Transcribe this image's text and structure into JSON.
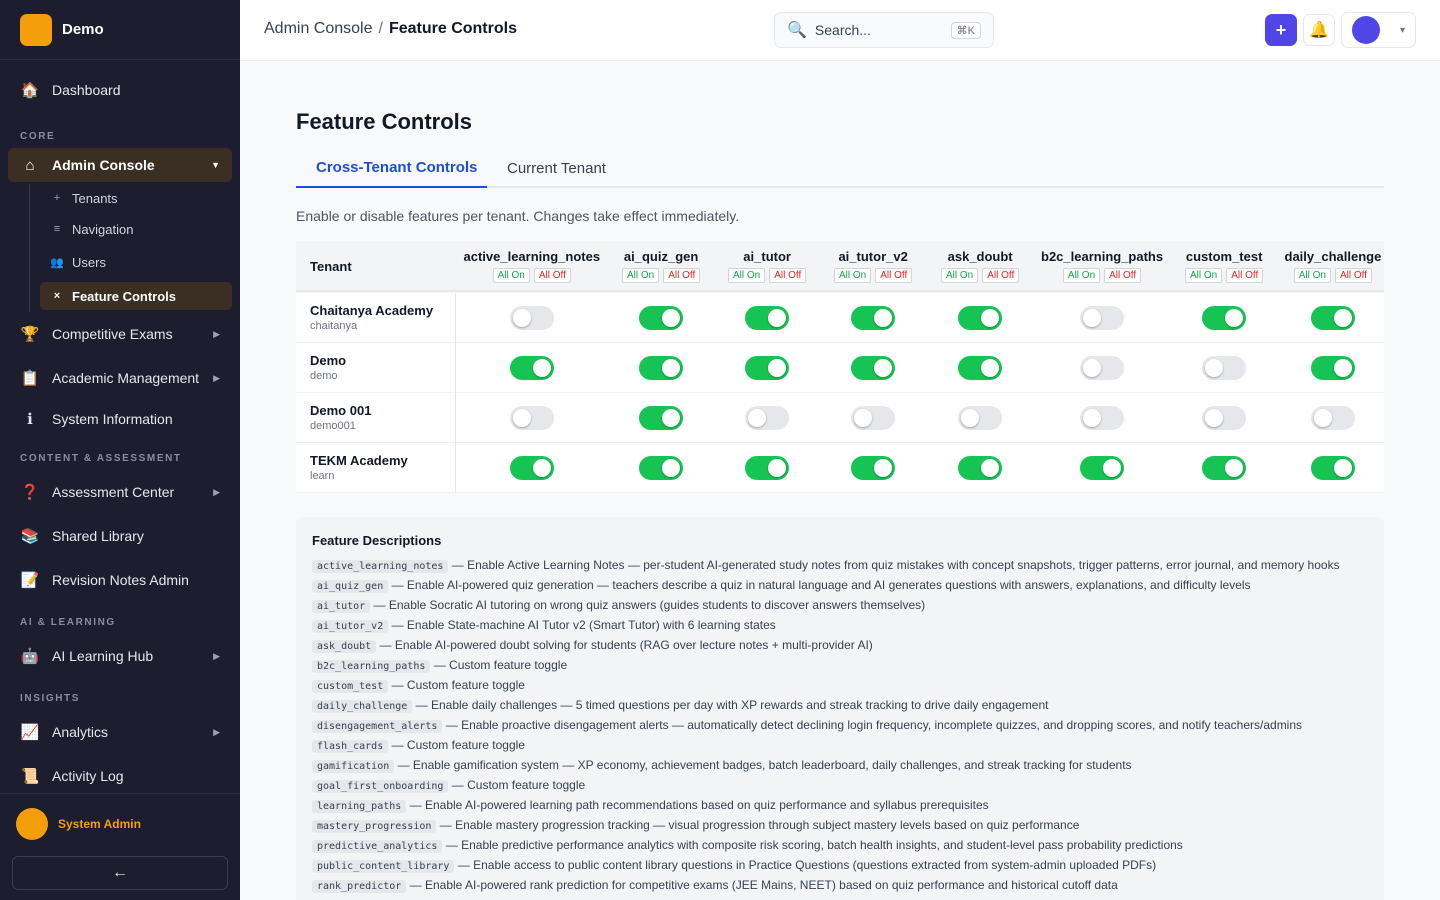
{
  "brand": {
    "name": "Demo"
  },
  "sidebar": {
    "sections": [
      "CORE",
      "CONTENT & ASSESSMENT",
      "AI & LEARNING",
      "INSIGHTS"
    ],
    "items": [
      {
        "label": "Dashboard",
        "icon": "🏠"
      },
      {
        "label": "Admin Console",
        "icon": "⌂"
      },
      {
        "label": "Competitive Exams",
        "icon": "🏆"
      },
      {
        "label": "Academic Management",
        "icon": "📋"
      },
      {
        "label": "System Information",
        "icon": "ℹ"
      },
      {
        "label": "Assessment Center",
        "icon": "❓"
      },
      {
        "label": "Shared Library",
        "icon": "📚"
      },
      {
        "label": "Revision Notes Admin",
        "icon": "📝"
      },
      {
        "label": "AI Learning Hub",
        "icon": "🤖"
      },
      {
        "label": "Analytics",
        "icon": "📈"
      },
      {
        "label": "Activity Log",
        "icon": "📜"
      }
    ],
    "subitems": [
      {
        "label": "Tenants",
        "icon": "+"
      },
      {
        "label": "Navigation",
        "icon": "≡"
      },
      {
        "label": "Users",
        "icon": "👥"
      },
      {
        "label": "Feature Controls",
        "icon": "×"
      }
    ],
    "user": "System Admin",
    "collapse": "←"
  },
  "topbar": {
    "crumb_parent": "Admin Console",
    "crumb_sep": "/",
    "crumb_current": "Feature Controls",
    "search_placeholder": "Search...",
    "search_shortcut": "⌘K",
    "plus": "+",
    "bell": "🔔",
    "profile_arrow": "▾"
  },
  "page": {
    "title": "Feature Controls",
    "tabs": [
      "Cross-Tenant Controls",
      "Current Tenant"
    ],
    "intro": "Enable or disable features per tenant. Changes take effect immediately.",
    "tenant_header": "Tenant",
    "all_on": "All On",
    "all_off": "All Off"
  },
  "features": [
    "active_learning_notes",
    "ai_quiz_gen",
    "ai_tutor",
    "ai_tutor_v2",
    "ask_doubt",
    "b2c_learning_paths",
    "custom_test",
    "daily_challenge"
  ],
  "tenants": [
    {
      "name": "Chaitanya Academy",
      "slug": "chaitanya",
      "states": [
        false,
        true,
        true,
        true,
        true,
        false,
        true,
        true
      ]
    },
    {
      "name": "Demo",
      "slug": "demo",
      "states": [
        true,
        true,
        true,
        true,
        true,
        false,
        false,
        true
      ]
    },
    {
      "name": "Demo 001",
      "slug": "demo001",
      "states": [
        false,
        true,
        false,
        false,
        false,
        false,
        false,
        false
      ]
    },
    {
      "name": "TEKM Academy",
      "slug": "learn",
      "states": [
        true,
        true,
        true,
        true,
        true,
        true,
        true,
        true
      ]
    }
  ],
  "descriptions_title": "Feature Descriptions",
  "descriptions": [
    {
      "key": "active_learning_notes",
      "text": "— Enable Active Learning Notes — per-student AI-generated study notes from quiz mistakes with concept snapshots, trigger patterns, error journal, and memory hooks"
    },
    {
      "key": "ai_quiz_gen",
      "text": "— Enable AI-powered quiz generation — teachers describe a quiz in natural language and AI generates questions with answers, explanations, and difficulty levels"
    },
    {
      "key": "ai_tutor",
      "text": "— Enable Socratic AI tutoring on wrong quiz answers (guides students to discover answers themselves)"
    },
    {
      "key": "ai_tutor_v2",
      "text": "— Enable State-machine AI Tutor v2 (Smart Tutor) with 6 learning states"
    },
    {
      "key": "ask_doubt",
      "text": "— Enable AI-powered doubt solving for students (RAG over lecture notes + multi-provider AI)"
    },
    {
      "key": "b2c_learning_paths",
      "text": "— Custom feature toggle"
    },
    {
      "key": "custom_test",
      "text": "— Custom feature toggle"
    },
    {
      "key": "daily_challenge",
      "text": "— Enable daily challenges — 5 timed questions per day with XP rewards and streak tracking to drive daily engagement"
    },
    {
      "key": "disengagement_alerts",
      "text": "— Enable proactive disengagement alerts — automatically detect declining login frequency, incomplete quizzes, and dropping scores, and notify teachers/admins"
    },
    {
      "key": "flash_cards",
      "text": "— Custom feature toggle"
    },
    {
      "key": "gamification",
      "text": "— Enable gamification system — XP economy, achievement badges, batch leaderboard, daily challenges, and streak tracking for students"
    },
    {
      "key": "goal_first_onboarding",
      "text": "— Custom feature toggle"
    },
    {
      "key": "learning_paths",
      "text": "— Enable AI-powered learning path recommendations based on quiz performance and syllabus prerequisites"
    },
    {
      "key": "mastery_progression",
      "text": "— Enable mastery progression tracking — visual progression through subject mastery levels based on quiz performance"
    },
    {
      "key": "predictive_analytics",
      "text": "— Enable predictive performance analytics with composite risk scoring, batch health insights, and student-level pass probability predictions"
    },
    {
      "key": "public_content_library",
      "text": "— Enable access to public content library questions in Practice Questions (questions extracted from system-admin uploaded PDFs)"
    },
    {
      "key": "rank_predictor",
      "text": "— Enable AI-powered rank prediction for competitive exams (JEE Mains, NEET) based on quiz performance and historical cutoff data"
    }
  ]
}
